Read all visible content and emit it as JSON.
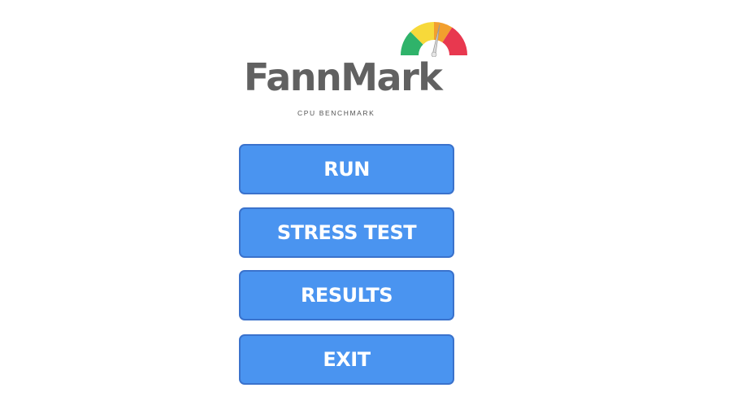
{
  "logo": {
    "brand": "FannMark",
    "tagline": "CPU BENCHMARK",
    "gauge_colors": [
      "#2fb36a",
      "#f7d93a",
      "#f29f2e",
      "#e8384f"
    ],
    "brand_color": "#616161"
  },
  "menu": {
    "run_label": "RUN",
    "stress_label": "STRESS TEST",
    "results_label": "RESULTS",
    "exit_label": "EXIT"
  },
  "colors": {
    "button_fill": "#4a94f0",
    "button_border": "#3a72cc",
    "button_text": "#ffffff",
    "background": "#ffffff"
  }
}
